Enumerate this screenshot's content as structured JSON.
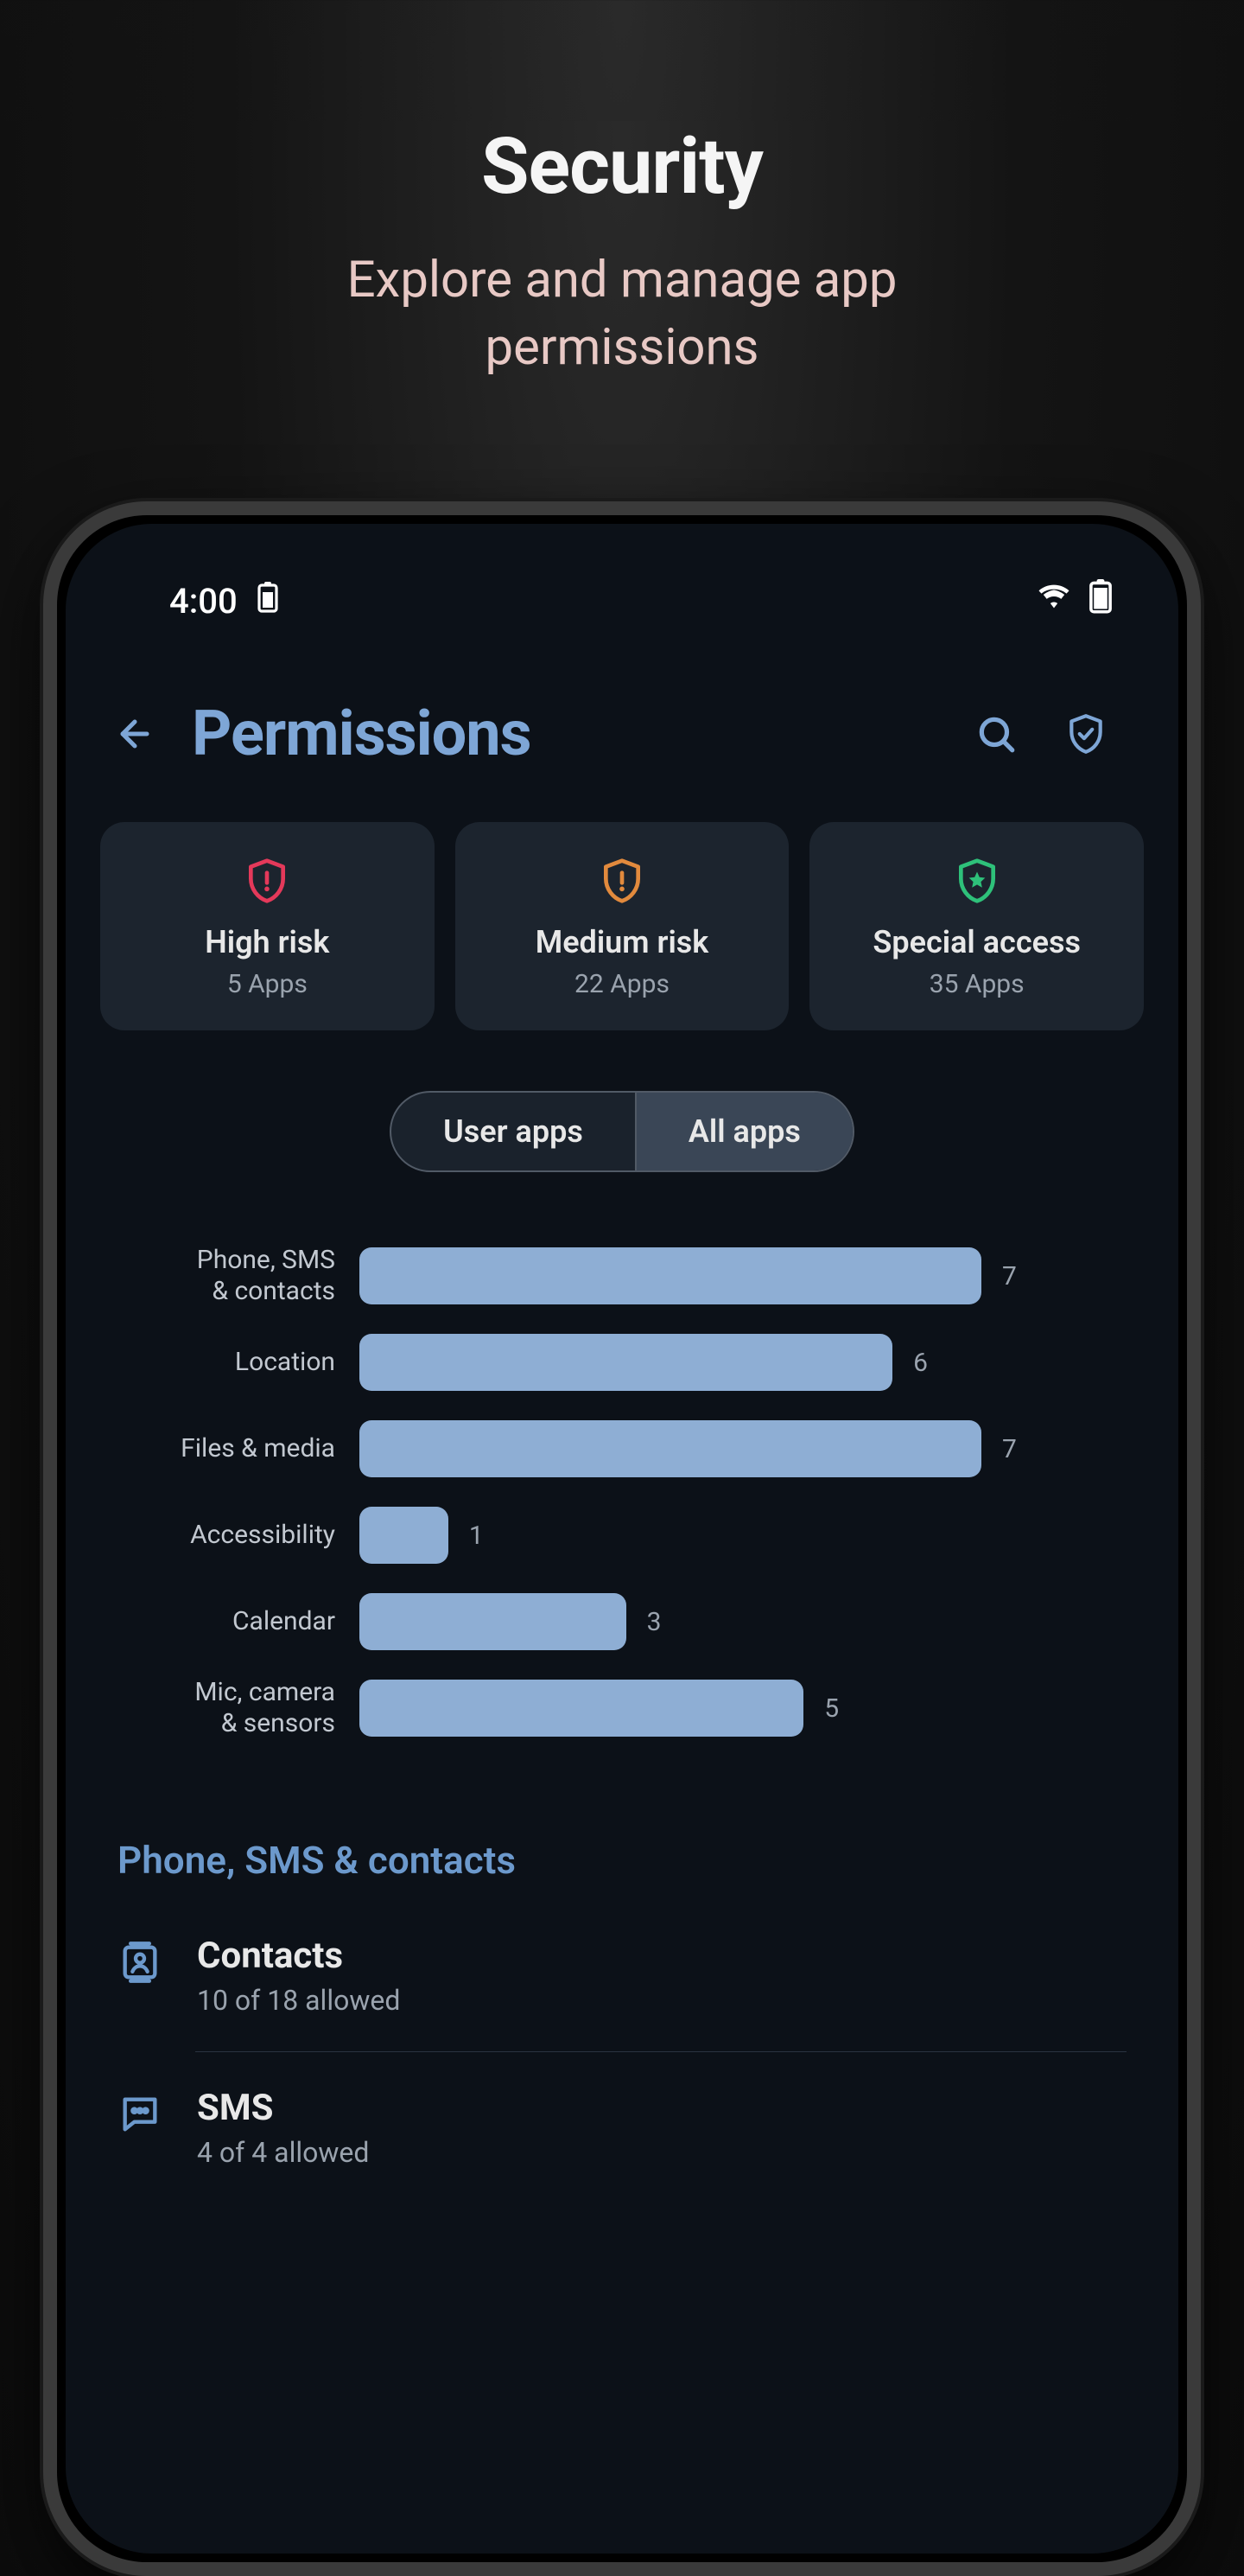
{
  "promo": {
    "title": "Security",
    "subtitle_line1": "Explore and manage app",
    "subtitle_line2": "permissions"
  },
  "status": {
    "time": "4:00"
  },
  "header": {
    "title": "Permissions"
  },
  "risk_cards": [
    {
      "label": "High risk",
      "sub": "5 Apps",
      "color": "#e4395a"
    },
    {
      "label": "Medium risk",
      "sub": "22 Apps",
      "color": "#e28a3d"
    },
    {
      "label": "Special access",
      "sub": "35 Apps",
      "color": "#2ec17a"
    }
  ],
  "toggle": {
    "options": [
      "User apps",
      "All apps"
    ],
    "active_index": 1
  },
  "chart_data": {
    "type": "bar",
    "title": "",
    "xlabel": "",
    "ylabel": "",
    "categories": [
      "Phone, SMS & contacts",
      "Location",
      "Files & media",
      "Accessibility",
      "Calendar",
      "Mic, camera & sensors"
    ],
    "values": [
      7,
      6,
      7,
      1,
      3,
      5
    ],
    "ylim": [
      0,
      7
    ]
  },
  "section": {
    "title": "Phone, SMS & contacts"
  },
  "permissions": [
    {
      "title": "Contacts",
      "sub": "10 of 18 allowed",
      "icon": "contacts"
    },
    {
      "title": "SMS",
      "sub": "4 of 4 allowed",
      "icon": "sms"
    }
  ]
}
